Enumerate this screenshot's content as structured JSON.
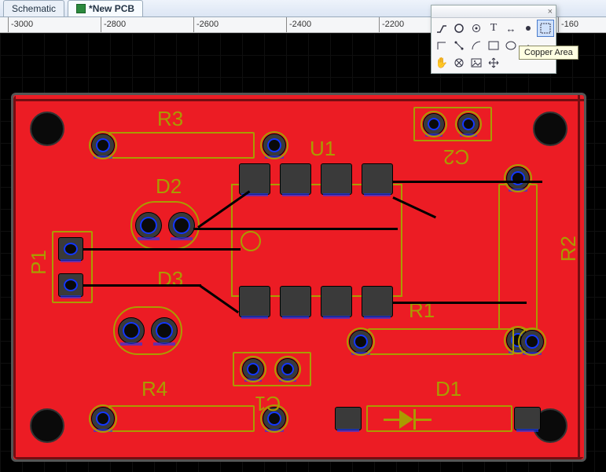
{
  "tabs": {
    "schematic": "Schematic",
    "pcb": "*New PCB"
  },
  "ruler": {
    "labels": [
      "-3000",
      "-2800",
      "-2600",
      "-2400",
      "-2200",
      "",
      "-160"
    ]
  },
  "tooltip": "Copper Area",
  "components": {
    "R1": "R1",
    "R2": "R2",
    "R3": "R3",
    "R4": "R4",
    "D1": "D1",
    "D2": "D2",
    "D3": "D3",
    "C1": "C1",
    "C2": "C2",
    "U1": "U1",
    "P1": "P1"
  },
  "palette": {
    "tools": [
      "track",
      "pad-round",
      "via",
      "text",
      "ruler",
      "hole",
      "copper-area",
      "polyline",
      "dimension",
      "arc",
      "rect",
      "ellipse",
      "protractor",
      "",
      "pan",
      "no-connect",
      "image",
      "group-move",
      "",
      "",
      ""
    ],
    "selected": "copper-area"
  }
}
